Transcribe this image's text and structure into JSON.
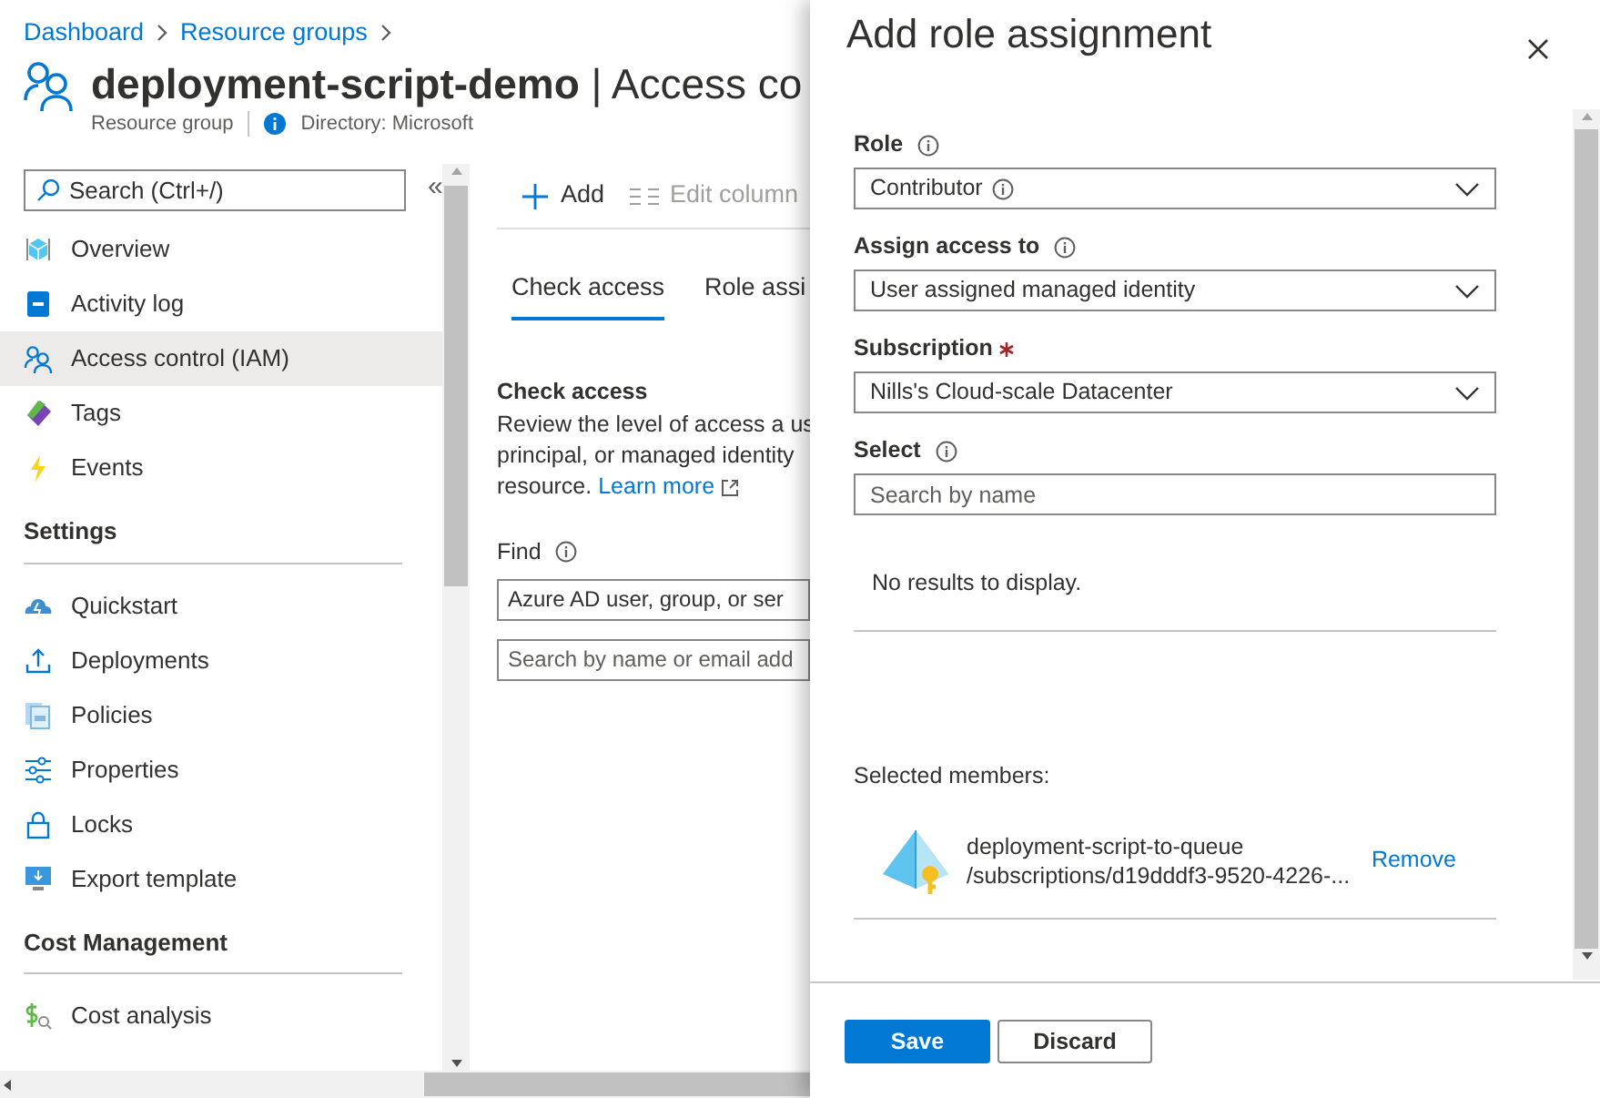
{
  "breadcrumb": [
    {
      "label": "Dashboard"
    },
    {
      "label": "Resource groups"
    }
  ],
  "header": {
    "title": "deployment-script-demo",
    "title_suffix": "| Access co",
    "subtitle": "Resource group",
    "directory": "Directory: Microsoft"
  },
  "sidebar": {
    "search_placeholder": "Search (Ctrl+/)",
    "collapse": "«",
    "sections": [
      {
        "items": [
          {
            "label": "Overview",
            "selected": false
          },
          {
            "label": "Activity log",
            "selected": false
          },
          {
            "label": "Access control (IAM)",
            "selected": true
          },
          {
            "label": "Tags",
            "selected": false
          },
          {
            "label": "Events",
            "selected": false
          }
        ]
      },
      {
        "heading": "Settings",
        "items": [
          {
            "label": "Quickstart",
            "selected": false
          },
          {
            "label": "Deployments",
            "selected": false
          },
          {
            "label": "Policies",
            "selected": false
          },
          {
            "label": "Properties",
            "selected": false
          },
          {
            "label": "Locks",
            "selected": false
          },
          {
            "label": "Export template",
            "selected": false
          }
        ]
      },
      {
        "heading": "Cost Management",
        "items": [
          {
            "label": "Cost analysis",
            "selected": false
          }
        ]
      }
    ]
  },
  "toolbar": [
    {
      "label": "Add",
      "disabled": false
    },
    {
      "label": "Edit column",
      "disabled": true
    }
  ],
  "tabs": [
    {
      "label": "Check access",
      "selected": true
    },
    {
      "label": "Role assi",
      "selected": false
    }
  ],
  "check_access": {
    "heading": "Check access",
    "description_lines": [
      "Review the level of access a us",
      "principal, or managed identity",
      "resource."
    ],
    "link": "Learn more",
    "find_label": "Find",
    "find_value": "Azure AD user, group, or ser",
    "search_placeholder": "Search by name or email add"
  },
  "panel": {
    "title": "Add role assignment",
    "fields": [
      {
        "kind": "select",
        "label": "Role",
        "info": true,
        "value": "Contributor",
        "value_info": true
      },
      {
        "kind": "select",
        "label": "Assign access to",
        "info": true,
        "value": "User assigned managed identity"
      },
      {
        "kind": "select",
        "label": "Subscription",
        "required": true,
        "value": "Nills's Cloud-scale Datacenter"
      },
      {
        "kind": "search",
        "label": "Select",
        "info": true,
        "placeholder": "Search by name"
      }
    ],
    "no_results": "No results to display.",
    "selected_label": "Selected members:",
    "members": [
      {
        "name": "deployment-script-to-queue",
        "path": "/subscriptions/d19dddf3-9520-4226-...",
        "action": "Remove"
      }
    ],
    "buttons": [
      {
        "label": "Save",
        "kind": "primary"
      },
      {
        "label": "Discard",
        "kind": "secondary"
      }
    ]
  }
}
